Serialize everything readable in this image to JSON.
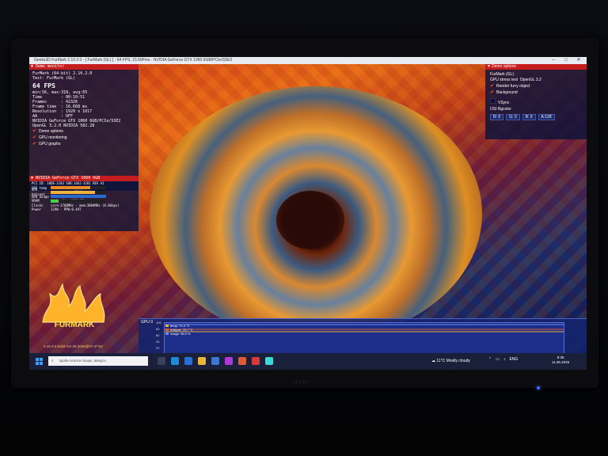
{
  "window": {
    "title": "Geeks3D FurMark 2.10.2.0 - [ FurMark (GL) ] - 64 FPS, 15.59Fms - NVIDIA GeForce GTX 1060 6GB/PCIe/SSE2",
    "controls": [
      "–",
      "□",
      "✕"
    ]
  },
  "monitor": {
    "header": "Demo monitor",
    "app_line": "FurMark (64-bit) 2.10.2.0",
    "test_line": "Test: FurMark (GL)",
    "fps": "64 FPS",
    "fps_stats": "min:56, max:318, avg:65",
    "stats": [
      {
        "k": "Time",
        "v": ": 00:10:51"
      },
      {
        "k": "Frames",
        "v": ": 42326"
      },
      {
        "k": "Frame time",
        "v": ": 16.668 ms"
      },
      {
        "k": "Resolution",
        "v": ": 1920 x 1017"
      },
      {
        "k": "AA",
        "v": ": OFF"
      }
    ],
    "gpu_line": "NVIDIA GeForce GTX 1060 6GB/PCIe/SSE2",
    "gl_line": "OpenGL 3.2.0 NVIDIA 582.28",
    "checks": [
      "Demo options",
      "GPU monitoring",
      "GPU graphs"
    ]
  },
  "gpu_panel": {
    "header": "NVIDIA GeForce GTX 1060 6GB",
    "pci": "PCI ID: 10DE-1C03 SUB:1462-3281 REV A1",
    "rows": [
      {
        "k": "GPU temp",
        "v": "71°C",
        "fill": 0.71,
        "color": "#e8892a"
      },
      {
        "k": "GPU hotspot",
        "v": "80°C",
        "fill": 0.8,
        "color": "#f0b23a"
      },
      {
        "k": "GPU usage",
        "v": "0%",
        "fill": 1.0,
        "color": "#2a6ad0"
      },
      {
        "k": "VRAM",
        "v": "14% (838 MB)",
        "fill": 0.14,
        "color": "#4ad04a"
      }
    ],
    "clocks": "core:1760MHz - mem:3004MHz (8.0Gbps)",
    "power": "129W - PPW:0.497"
  },
  "demo_options": {
    "header": "Demo options",
    "name": "FurMark (GL)",
    "stress_label": "GPU stress test",
    "stress_value": "OpenGL 3.2",
    "checks": [
      "Render furry object",
      "Background"
    ],
    "vsync": "VSync",
    "bg_label": "OSI Bgcolor",
    "bg_values": [
      "R: 0",
      "G: 0",
      "B: 0",
      "A:128"
    ]
  },
  "graph": {
    "label": "GPU 0",
    "y_ticks": [
      "100",
      "80",
      "60",
      "40",
      "20"
    ],
    "legend": [
      {
        "text": "temp: 71.3 °C",
        "color": "#f0b23a"
      },
      {
        "text": "hotspot: 79.7 °C",
        "color": "#e05a2a"
      },
      {
        "text": "usage: 98.5 %",
        "color": "#6a8af0"
      }
    ]
  },
  "logo": {
    "text": "FURMARK"
  },
  "version": "2.10.2.0 build Oct 28 2025@07:47:52",
  "taskbar": {
    "search_placeholder": "Щоби почати пошук, введіть",
    "weather_temp": "11°C",
    "weather_desc": "Mostly cloudy",
    "lang": "ENG",
    "time": "8:35",
    "date": "11.06.2026"
  },
  "monitor_brand": "acer"
}
